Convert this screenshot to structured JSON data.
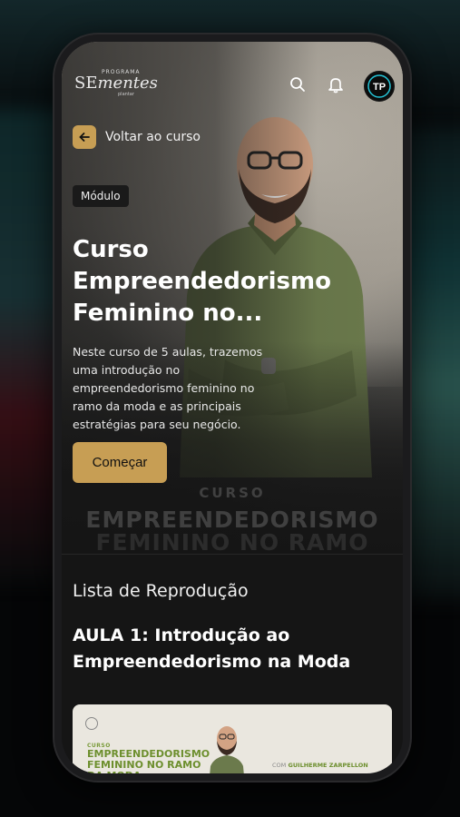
{
  "app": {
    "logo_top": "PROGRAMA",
    "logo_main_a": "SE",
    "logo_main_b": "mentes",
    "logo_sub": "plantar",
    "avatar_initials": "TP"
  },
  "header": {
    "icons": [
      "search-icon",
      "bell-icon"
    ]
  },
  "back": {
    "label": "Voltar ao curso"
  },
  "course": {
    "badge": "Módulo",
    "title": "Curso Empreendedorismo Feminino no...",
    "description": "Neste curso de 5 aulas, trazemos uma introdução no empreendedorismo feminino no ramo da moda e as principais estratégias para seu negócio.",
    "start_label": "Começar"
  },
  "hero_overlay": {
    "line1": "CURSO",
    "line2": "EMPREENDEDORISMO",
    "line3": "FEMININO NO RAMO"
  },
  "playlist": {
    "heading": "Lista de Reprodução",
    "lesson_title": "AULA 1: Introdução ao Empreendedorismo na Moda",
    "card": {
      "line1": "CURSO",
      "title": "EMPREENDEDORISMO FEMININO NO RAMO DA MODA",
      "author_label": "COM",
      "author_name": "GUILHERME ZARPELLON"
    }
  },
  "colors": {
    "accent": "#c79e54",
    "background": "#151515"
  }
}
